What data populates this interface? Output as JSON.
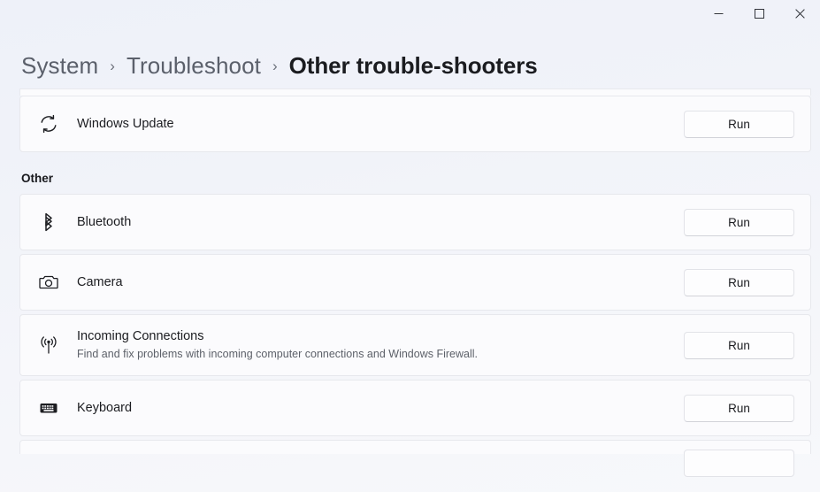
{
  "window": {
    "controls": [
      {
        "name": "minimize",
        "glyph": "minimize-icon",
        "label": "Minimize"
      },
      {
        "name": "maximize",
        "glyph": "maximize-icon",
        "label": "Maximize"
      },
      {
        "name": "close",
        "glyph": "close-icon",
        "label": "Close"
      }
    ]
  },
  "breadcrumb": {
    "items": [
      {
        "label": "System",
        "current": false
      },
      {
        "label": "Troubleshoot",
        "current": false
      },
      {
        "label": "Other trouble-shooters",
        "current": true
      }
    ],
    "separator": "›"
  },
  "colors": {
    "page_background": "#eef1f8",
    "card_background": "#fbfbfd",
    "card_border": "#e7e8ed",
    "title_text": "#1b1c20",
    "muted_text": "#5d6169",
    "breadcrumb_link": "#5b606b"
  },
  "run_button_label": "Run",
  "sections": [
    {
      "id": "recommended-continued",
      "header": null,
      "items": [
        {
          "icon": "sync-refresh-icon",
          "title": "Windows Update",
          "description": null,
          "action": "Run"
        }
      ]
    },
    {
      "id": "other",
      "header": "Other",
      "items": [
        {
          "icon": "bluetooth-icon",
          "title": "Bluetooth",
          "description": null,
          "action": "Run"
        },
        {
          "icon": "camera-icon",
          "title": "Camera",
          "description": null,
          "action": "Run"
        },
        {
          "icon": "broadcast-antenna-icon",
          "title": "Incoming Connections",
          "description": "Find and fix problems with incoming computer connections and Windows Firewall.",
          "action": "Run"
        },
        {
          "icon": "keyboard-icon",
          "title": "Keyboard",
          "description": null,
          "action": "Run"
        }
      ]
    }
  ]
}
